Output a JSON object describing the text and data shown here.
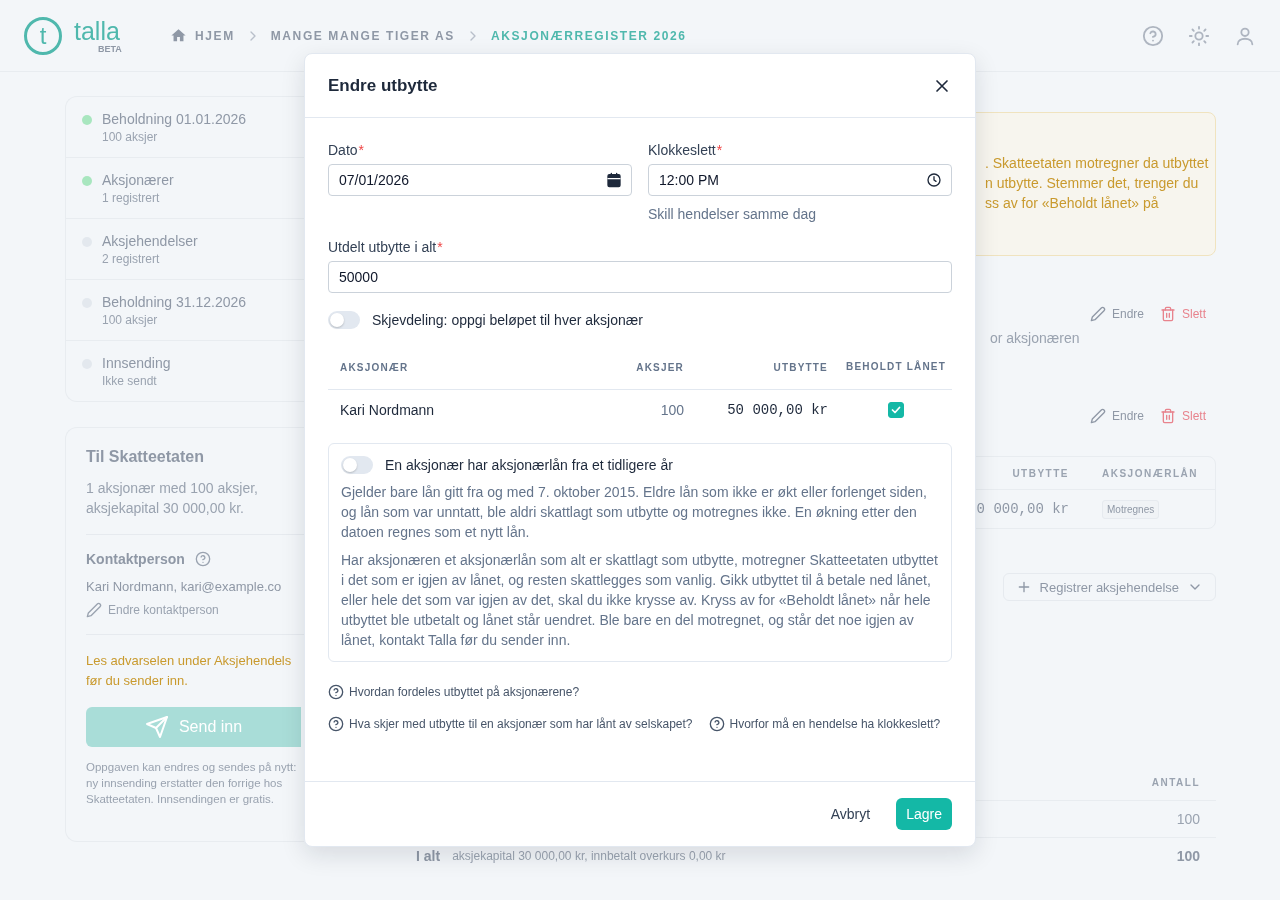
{
  "header": {
    "logo": {
      "mark": "t",
      "name": "talla",
      "badge": "BETA"
    },
    "breadcrumbs": [
      {
        "label": "HJEM",
        "selected": false,
        "kind": "home"
      },
      {
        "label": "MANGE MANGE TIGER AS",
        "selected": false,
        "kind": "page"
      },
      {
        "label": "AKSJONÆRREGISTER 2026",
        "selected": true,
        "kind": "page"
      }
    ]
  },
  "steps": [
    {
      "title": "Beholdning 01.01.2026",
      "subtitle": "100 aksjer",
      "done": true
    },
    {
      "title": "Aksjonærer",
      "subtitle": "1 registrert",
      "done": true
    },
    {
      "title": "Aksjehendelser",
      "subtitle": "2 registrert",
      "done": false
    },
    {
      "title": "Beholdning 31.12.2026",
      "subtitle": "100 aksjer",
      "done": false
    },
    {
      "title": "Innsending",
      "subtitle": "Ikke sendt",
      "done": false
    }
  ],
  "submit_card": {
    "title": "Til Skatteetaten",
    "summary": "1 aksjonær med 100 aksjer, aksjekapital 30 000,00 kr.",
    "contact_title": "Kontaktperson",
    "contact": "Kari Nordmann, kari@example.co",
    "edit_contact": "Endre kontaktperson",
    "warning": {
      "link": "Les advarselen",
      "text": "under Aksjehendels",
      "line2": "før du sender inn."
    },
    "send_button": "Send inn",
    "note_lines": [
      "Oppgaven kan endres og sendes på nytt:",
      "ny innsending erstatter den forrige hos",
      "Skatteetaten. Innsendingen er gratis."
    ]
  },
  "main": {
    "notice_lines": [
      ". Skatteetaten motregner da utbyttet",
      "n utbytte. Stemmer det, trenger du",
      "ss av for «Beholdt lånet» på"
    ],
    "events": [
      {
        "actions": [
          "Endre",
          "Slett"
        ],
        "text": "or aksjonæren"
      },
      {
        "actions": [
          "Endre",
          "Slett"
        ],
        "table": {
          "columns": [
            "UTBYTTE",
            "AKSJONÆRLÅN"
          ],
          "row": [
            "0 000,00 kr",
            "Motregnes"
          ]
        }
      }
    ],
    "add_button": "Registrer aksjehendelse",
    "holdings": {
      "column": "ANTALL",
      "rows": [
        {
          "label": "",
          "sub": "",
          "value": "100",
          "kind": "row"
        },
        {
          "label": "I alt",
          "sub": "aksjekapital 30 000,00 kr, innbetalt overkurs 0,00 kr",
          "value": "100",
          "kind": "total"
        }
      ]
    }
  },
  "modal": {
    "title": "Endre utbytte",
    "date": {
      "label": "Dato",
      "required_mark": "*",
      "value": "07/01/2026"
    },
    "time": {
      "label": "Klokkeslett",
      "required_mark": "*",
      "value": "12:00 PM",
      "link": "Skill hendelser samme dag"
    },
    "total": {
      "label": "Utdelt utbytte i alt",
      "required_mark": "*",
      "value": "50000"
    },
    "split_toggle": {
      "label": "Skjevdeling: oppgi beløpet til hver aksjonær",
      "on": false
    },
    "table": {
      "columns": [
        "AKSJONÆR",
        "AKSJER",
        "UTBYTTE",
        "BEHOLDT LÅNET"
      ],
      "rows": [
        {
          "name": "Kari Nordmann",
          "shares": "100",
          "dividend": "50 000,00 kr",
          "kept_loan": true
        }
      ]
    },
    "loan_box": {
      "label": "En aksjonær har aksjonærlån fra et tidligere år",
      "on": false,
      "paragraphs": [
        "Gjelder bare lån gitt fra og med 7. oktober 2015. Eldre lån som ikke er økt eller forlenget siden, og lån som var unntatt, ble aldri skattlagt som utbytte og motregnes ikke. En økning etter den datoen regnes som et nytt lån.",
        "Har aksjonæren et aksjonærlån som alt er skattlagt som utbytte, motregner Skatteetaten utbyttet i det som er igjen av lånet, og resten skattlegges som vanlig. Gikk utbyttet til å betale ned lånet, eller hele det som var igjen av det, skal du ikke krysse av. Kryss av for «Beholdt lånet» når hele utbyttet ble utbetalt og lånet står uendret. Ble bare en del motregnet, og står det noe igjen av lånet, kontakt Talla før du sender inn."
      ]
    },
    "help_links": [
      [
        "Hvordan fordeles utbyttet på aksjonærene?"
      ],
      [
        "Hva skjer med utbytte til en aksjonær som har lånt av selskapet?",
        "Hvorfor må en hendelse ha klokkeslett?"
      ]
    ],
    "buttons": [
      "Avbryt",
      "Lagre"
    ]
  }
}
